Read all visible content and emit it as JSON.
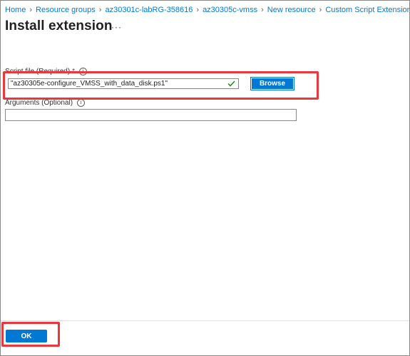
{
  "breadcrumb": [
    {
      "label": "Home"
    },
    {
      "label": "Resource groups"
    },
    {
      "label": "az30301c-labRG-358616"
    },
    {
      "label": "az30305c-vmss"
    },
    {
      "label": "New resource"
    },
    {
      "label": "Custom Script Extension"
    }
  ],
  "page": {
    "title": "Install extension",
    "more_label": "···"
  },
  "script_file": {
    "label": "Script file (Required)",
    "required_mark": "*",
    "info_glyph": "i",
    "value": "\"az30305e-configure_VMSS_with_data_disk.ps1\"",
    "browse_label": "Browse"
  },
  "arguments": {
    "label": "Arguments (Optional)",
    "info_glyph": "i",
    "value": ""
  },
  "footer": {
    "ok_label": "OK"
  },
  "colors": {
    "accent": "#0078d4",
    "highlight": "#e8383d",
    "valid_check": "#107c10"
  },
  "icons": [
    "chevron-right-icon",
    "more-icon",
    "info-icon",
    "checkmark-icon"
  ]
}
